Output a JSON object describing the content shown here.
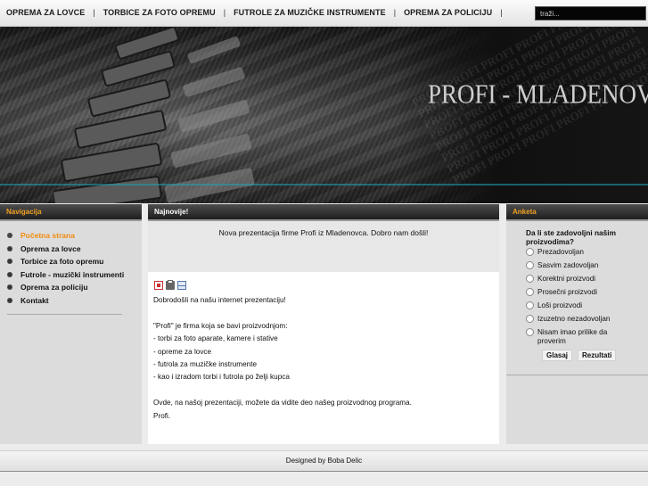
{
  "top_menu": {
    "items": [
      {
        "label": "OPREMA ZA LOVCE"
      },
      {
        "label": "TORBICE ZA FOTO OPREMU"
      },
      {
        "label": "FUTROLE ZA MUZIČKE INSTRUMENTE"
      },
      {
        "label": "OPREMA ZA POLICIJU"
      }
    ],
    "separator": "|"
  },
  "search": {
    "value": "traži..."
  },
  "banner": {
    "title": "PROFI - MLADENOVAC",
    "watermark": "PROFI PROFI PROFI PROFI PROFI PROFI PROFI PROFI PROFI PROFI PROFI PROFI PROFI PROFI PROFI PROFI PROFI PROFI"
  },
  "navigation": {
    "header": "Navigacija",
    "items": [
      {
        "label": "Početna strana",
        "active": true
      },
      {
        "label": "Oprema za lovce"
      },
      {
        "label": "Torbice za foto opremu"
      },
      {
        "label": "Futrole - muzički instrumenti"
      },
      {
        "label": "Oprema za policiju"
      },
      {
        "label": "Kontakt"
      }
    ]
  },
  "main": {
    "header": "Najnovije!",
    "news": "Nova prezentacija firme Profi iz Mladenovca. Dobro nam došli!",
    "icons": [
      "pdf-icon",
      "print-icon",
      "email-icon"
    ],
    "welcome": "Dobrodošli na našu internet prezentaciju!",
    "intro": "\"Profi\" je firma koja se bavi proizvodnjom:",
    "list": [
      "- torbi za foto aparate, kamere i stative",
      "- opreme za lovce",
      "- futrola za muzičke instrumente",
      "- kao i izradom torbi i futrola po želji kupca"
    ],
    "outro": "Ovde, na našoj prezentaciji, možete da vidite deo našeg proizvodnog programa.",
    "signature": "Profi."
  },
  "poll": {
    "header": "Anketa",
    "question": "Da li ste zadovoljni našim proizvodima?",
    "options": [
      "Prezadovoljan",
      "Sasvim zadovoljan",
      "Korektni proizvodi",
      "Prosečni proizvodi",
      "Loši proizvodi",
      "Izuzetno nezadovoljan",
      "Nisam imao prilike da proverim"
    ],
    "vote_label": "Glasaj",
    "results_label": "Rezultati"
  },
  "footer": {
    "text": "Designed by Boba Delic"
  },
  "colors": {
    "accent": "#f08c10",
    "header_dark": "#1e1e1e",
    "banner_line": "#1fa3b8"
  }
}
